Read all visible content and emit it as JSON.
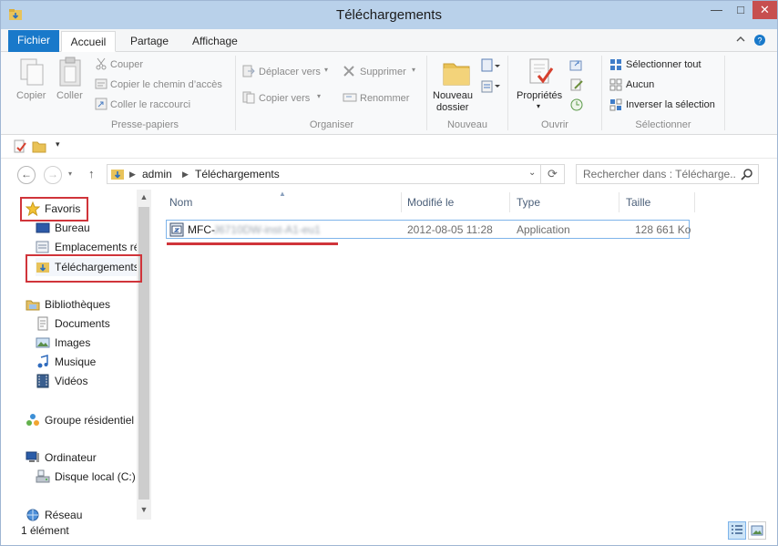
{
  "window": {
    "title": "Téléchargements",
    "controls": {
      "minimize": "—",
      "maximize": "□",
      "close": "✕"
    }
  },
  "ribbon": {
    "tabs": [
      {
        "label": "Fichier",
        "active": false
      },
      {
        "label": "Accueil",
        "active": true
      },
      {
        "label": "Partage",
        "active": false
      },
      {
        "label": "Affichage",
        "active": false
      }
    ],
    "groups": {
      "clipboard": {
        "label": "Presse-papiers",
        "copy": "Copier",
        "paste": "Coller",
        "cut": "Couper",
        "copy_path": "Copier le chemin d’accès",
        "paste_shortcut": "Coller le raccourci"
      },
      "organize": {
        "label": "Organiser",
        "move_to": "Déplacer vers",
        "copy_to": "Copier vers",
        "delete": "Supprimer",
        "rename": "Renommer"
      },
      "new": {
        "label": "Nouveau",
        "new_folder_line1": "Nouveau",
        "new_folder_line2": "dossier"
      },
      "open": {
        "label": "Ouvrir",
        "properties": "Propriétés"
      },
      "select": {
        "label": "Sélectionner",
        "select_all": "Sélectionner tout",
        "select_none": "Aucun",
        "invert": "Inverser la sélection"
      }
    }
  },
  "address": {
    "segments": [
      "admin",
      "Téléchargements"
    ],
    "search_placeholder": "Rechercher dans : Télécharge..."
  },
  "navpane": {
    "favorites": {
      "label": "Favoris",
      "items": [
        "Bureau",
        "Emplacements récents",
        "Téléchargements"
      ]
    },
    "libraries": {
      "label": "Bibliothèques",
      "items": [
        "Documents",
        "Images",
        "Musique",
        "Vidéos"
      ]
    },
    "homegroup": "Groupe résidentiel",
    "computer": {
      "label": "Ordinateur",
      "items": [
        "Disque local (C:)"
      ]
    },
    "network": "Réseau"
  },
  "filelist": {
    "columns": [
      "Nom",
      "Modifié le",
      "Type",
      "Taille"
    ],
    "rows": [
      {
        "name_prefix": "MFC-",
        "name_redacted": "J6710DW-inst-A1-eu1",
        "modified": "2012-08-05 11:28",
        "type": "Application",
        "size": "128 661 Ko"
      }
    ]
  },
  "status": {
    "item_count": "1 élément"
  },
  "colors": {
    "accent": "#1979ca",
    "titlebar": "#b9d1ea",
    "annotation": "#d0343a",
    "selection_border": "#7eb4ea"
  }
}
